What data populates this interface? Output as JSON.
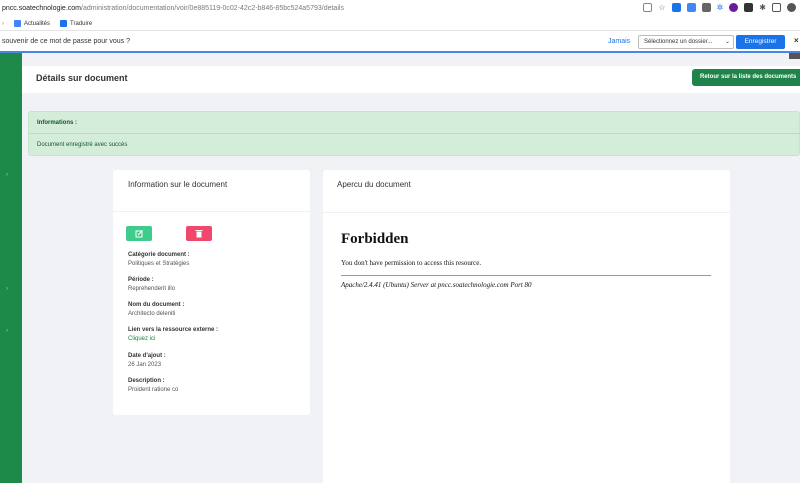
{
  "browser": {
    "url_host": "pncc.soatechnologie.com",
    "url_path": "/administration/documentation/voir/0e885119-0c02-42c2-b846-85bc524a5793/details",
    "bookmarks": [
      {
        "label": "Actualités",
        "icon": "news-icon"
      },
      {
        "label": "Traduire",
        "icon": "translate-icon"
      }
    ],
    "toolbar_icon_colors": [
      "#888888",
      "#888888",
      "#1a73e8",
      "#4285f4",
      "#666666",
      "#1a73e8",
      "#6a1b9a",
      "#333333",
      "#555555",
      "#555555",
      "#555555"
    ]
  },
  "password_bar": {
    "question": "souvenir de ce mot de passe pour vous ?",
    "never": "Jamais",
    "folder_select": "Sélectionnez un dossier...",
    "save": "Enregistrer"
  },
  "header": {
    "title": "Détails sur document",
    "back_button": "Retour sur la liste des documents"
  },
  "alert": {
    "title": "Informations :",
    "message": "Document enregistré avec succès"
  },
  "info_card": {
    "title": "Information sur le document",
    "fields": [
      {
        "label": "Catégorie document :",
        "value": "Politiques et Stratégies"
      },
      {
        "label": "Période :",
        "value": "Reprehenderit illo"
      },
      {
        "label": "Nom du document :",
        "value": "Architecto deleniti"
      },
      {
        "label": "Lien vers la ressource externe :",
        "value": "Cliquez ici"
      },
      {
        "label": "Date d'ajout :",
        "value": "26 Jan 2023"
      },
      {
        "label": "Description :",
        "value": "Proident ratione co"
      }
    ]
  },
  "preview_card": {
    "title": "Apercu du document",
    "frame": {
      "heading": "Forbidden",
      "message": "You don't have permission to access this resource.",
      "address": "Apache/2.4.41 (Ubuntu) Server at pncc.soatechnologie.com Port 80"
    }
  },
  "colors": {
    "sidebar": "#1d8a4a",
    "primary_button": "#1e8449",
    "alert_bg": "#d4edda",
    "edit_button": "#3ecb8c",
    "delete_button": "#f0476a"
  }
}
